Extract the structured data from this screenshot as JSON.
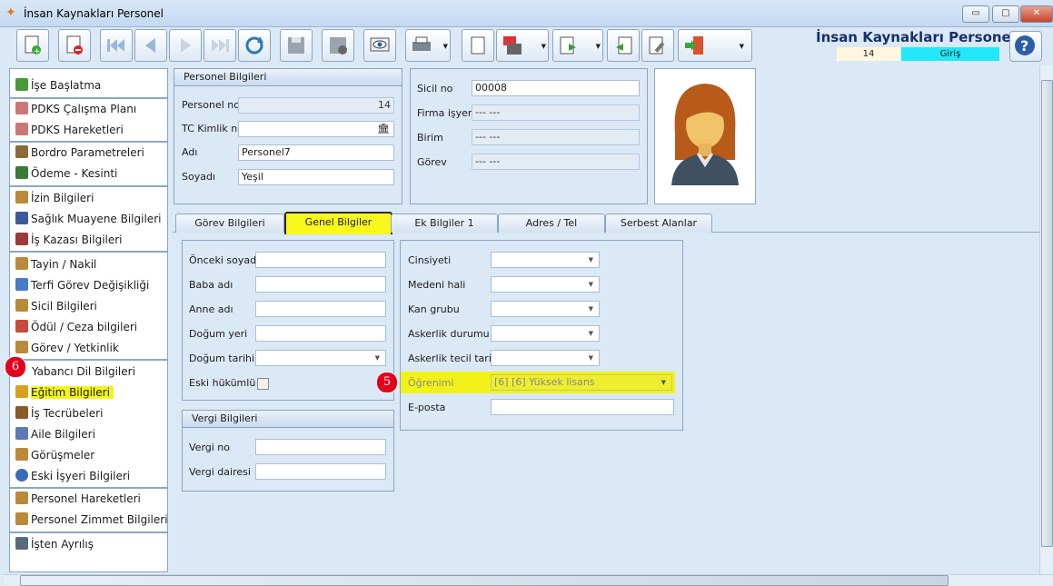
{
  "window": {
    "title": "İnsan Kaynakları Personel",
    "minimize": "▭",
    "maximize": "▢",
    "close": "✕"
  },
  "header": {
    "app_title": "İnsan Kaynakları Personel",
    "record_no": "14",
    "mode": "Giriş"
  },
  "sidebar": {
    "groups": [
      [
        "İşe Başlatma"
      ],
      [
        "PDKS Çalışma Planı",
        "PDKS Hareketleri"
      ],
      [
        "Bordro Parametreleri",
        "Ödeme - Kesinti"
      ],
      [
        "İzin Bilgileri",
        "Sağlık Muayene Bilgileri",
        "İş Kazası Bilgileri"
      ],
      [
        "Tayin / Nakil",
        "Terfi Görev Değişikliği",
        "Sicil Bilgileri",
        "Ödül / Ceza bilgileri",
        "Görev / Yetkinlik"
      ],
      [
        "Yabancı Dil Bilgileri",
        "Eğitim Bilgileri",
        "İş Tecrübeleri",
        "Aile Bilgileri",
        "Görüşmeler",
        "Eski İşyeri Bilgileri"
      ],
      [
        "Personel Hareketleri",
        "Personel Zimmet Bilgileri"
      ],
      [
        "İşten Ayrılış"
      ]
    ],
    "highlighted": "Eğitim Bilgileri"
  },
  "markers": {
    "m6": "6",
    "m5": "5"
  },
  "personel": {
    "header": "Personel Bilgileri",
    "no_label": "Personel no",
    "no_value": "14",
    "tc_label": "TC Kimlik no",
    "tc_value": "",
    "adi_label": "Adı",
    "adi_value": "Personel7",
    "soyadi_label": "Soyadı",
    "soyadi_value": "Yeşil"
  },
  "sicil": {
    "sicil_label": "Sicil no",
    "sicil_value": "00008",
    "firma_label": "Firma işyeri",
    "firma_value": "--- ---",
    "birim_label": "Birim",
    "birim_value": "--- ---",
    "gorev_label": "Görev",
    "gorev_value": "--- ---"
  },
  "tabs": [
    "Görev Bilgileri",
    "Genel Bilgiler",
    "Ek Bilgiler 1",
    "Adres / Tel",
    "Serbest Alanlar"
  ],
  "genel_left": {
    "onceki_soyadi": "Önceki soyadı",
    "baba_adi": "Baba adı",
    "anne_adi": "Anne adı",
    "dogum_yeri": "Doğum yeri",
    "dogum_tarihi": "Doğum tarihi",
    "eski_hukumlu": "Eski hükümlü"
  },
  "vergi": {
    "header": "Vergi Bilgileri",
    "no": "Vergi no",
    "dairesi": "Vergi dairesi"
  },
  "genel_right": {
    "cinsiyet": "Cinsiyeti",
    "medeni": "Medeni hali",
    "kan": "Kan grubu",
    "askerlik": "Askerlik durumu",
    "askerlik_tecil": "Askerlik tecil tarihi",
    "ogrenim_label": "Öğrenimi",
    "ogrenim_value": "[6] [6] Yüksek lisans",
    "eposta": "E-posta"
  },
  "colors": {
    "accent": "#16306a",
    "highlight": "#f5f51a",
    "mode_bg": "#22e8f8",
    "marker": "#e3001b"
  }
}
